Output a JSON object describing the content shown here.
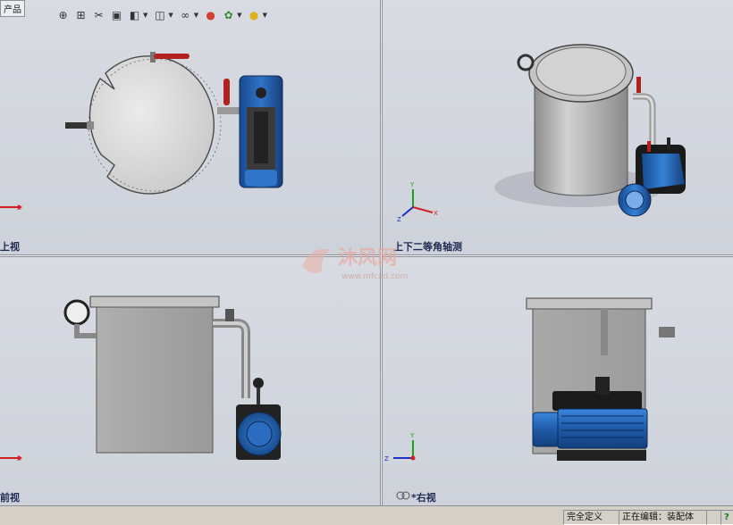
{
  "toolbar": {
    "buttons": [
      {
        "icon": "zoom-fit-icon",
        "glyph": "⊕"
      },
      {
        "icon": "zoom-area-icon",
        "glyph": "⊞"
      },
      {
        "icon": "section-view-icon",
        "glyph": "✂"
      },
      {
        "icon": "view-orientation-icon",
        "glyph": "▣"
      },
      {
        "icon": "display-style-icon",
        "glyph": "◧"
      },
      {
        "icon": "hide-show-icon",
        "glyph": "◫"
      },
      {
        "icon": "edit-appearance-icon",
        "glyph": "∞"
      },
      {
        "icon": "scene-icon",
        "glyph": "●"
      },
      {
        "icon": "view-settings-icon",
        "glyph": "✿"
      },
      {
        "icon": "lighting-icon",
        "glyph": "●"
      }
    ]
  },
  "tab_label": "产品",
  "viewports": {
    "top_left": {
      "label": "上视"
    },
    "top_right": {
      "label": "上下二等角轴测"
    },
    "bottom_left": {
      "label": "前视"
    },
    "bottom_right": {
      "label": "*右视"
    }
  },
  "axes": {
    "x": "X",
    "y": "Y",
    "z": "Z"
  },
  "watermark": {
    "brand": "沐风网",
    "url": "www.mfcad.com"
  },
  "status": {
    "defined": "完全定义",
    "editing": "正在编辑：装配体",
    "help": "?"
  },
  "colors": {
    "motor_blue": "#1e5aa8",
    "valve_red": "#b32020",
    "tank_grey": "#a8a8a8",
    "label_navy": "#1f2a55",
    "axis_x": "#d42020",
    "axis_y": "#20a020",
    "axis_z": "#2030c0"
  }
}
